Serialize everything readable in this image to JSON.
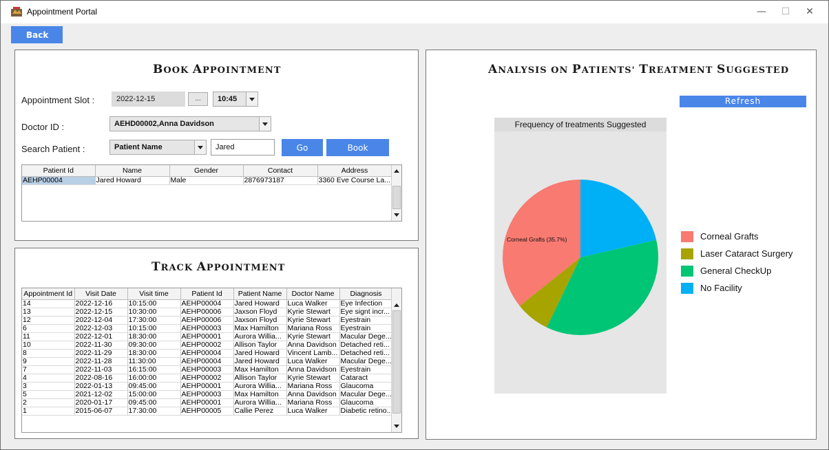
{
  "window": {
    "title": "Appointment Portal",
    "minimize": "—",
    "maximize": "☐",
    "close": "✕"
  },
  "back_label": "Back",
  "book": {
    "title_first": "B",
    "title_rest": "OOK ",
    "title_first2": "A",
    "title_rest2": "PPOINTMENT",
    "slot_label": "Appointment Slot :",
    "slot_date": "2022-12-15",
    "slot_picker": "...",
    "slot_time": "10:45",
    "doctor_label": "Doctor ID :",
    "doctor_value": "AEHD00002,Anna Davidson",
    "search_label": "Search Patient :",
    "search_by": "Patient Name",
    "search_text": "Jared",
    "go_label": "Go",
    "book_label": "Book",
    "table": {
      "headers": [
        "Patient Id",
        "Name",
        "Gender",
        "Contact",
        "Address"
      ],
      "rows": [
        [
          "AEHP00004",
          "Jared Howard",
          "Male",
          "2876973187",
          "3360 Eve Course La..."
        ]
      ]
    }
  },
  "track": {
    "title_first": "T",
    "title_rest": "RACK ",
    "title_first2": "A",
    "title_rest2": "PPOINTMENT",
    "table": {
      "headers": [
        "Appointment Id",
        "Visit Date",
        "Visit time",
        "Patient Id",
        "Patient Name",
        "Doctor Name",
        "Diagnosis"
      ],
      "rows": [
        [
          "14",
          "2022-12-16",
          "10:15:00",
          "AEHP00004",
          "Jared Howard",
          "Luca Walker",
          "Eye Infection"
        ],
        [
          "13",
          "2022-12-15",
          "10:30:00",
          "AEHP00006",
          "Jaxson Floyd",
          "Kyrie Stewart",
          "Eye signt incr..."
        ],
        [
          "12",
          "2022-12-04",
          "17:30:00",
          "AEHP00006",
          "Jaxson Floyd",
          "Kyrie Stewart",
          "Eyestrain"
        ],
        [
          "6",
          "2022-12-03",
          "10:15:00",
          "AEHP00003",
          "Max Hamilton",
          "Mariana Ross",
          "Eyestrain"
        ],
        [
          "11",
          "2022-12-01",
          "18:30:00",
          "AEHP00001",
          "Aurora Willia...",
          "Kyrie Stewart",
          "Macular Dege..."
        ],
        [
          "10",
          "2022-11-30",
          "09:30:00",
          "AEHP00002",
          "Allison Taylor",
          "Anna Davidson",
          "Detached reti..."
        ],
        [
          "8",
          "2022-11-29",
          "18:30:00",
          "AEHP00004",
          "Jared Howard",
          "Vincent Lamb...",
          "Detached reti..."
        ],
        [
          "9",
          "2022-11-28",
          "11:30:00",
          "AEHP00004",
          "Jared Howard",
          "Luca Walker",
          "Macular Dege..."
        ],
        [
          "7",
          "2022-11-03",
          "16:15:00",
          "AEHP00003",
          "Max Hamilton",
          "Anna Davidson",
          "Eyestrain"
        ],
        [
          "4",
          "2022-08-16",
          "16:00:00",
          "AEHP00002",
          "Allison Taylor",
          "Kyrie Stewart",
          "Cataract"
        ],
        [
          "3",
          "2022-01-13",
          "09:45:00",
          "AEHP00001",
          "Aurora Willia...",
          "Mariana Ross",
          "Glaucoma"
        ],
        [
          "5",
          "2021-12-02",
          "15:00:00",
          "AEHP00003",
          "Max Hamilton",
          "Anna Davidson",
          "Macular Dege..."
        ],
        [
          "2",
          "2020-01-17",
          "09:45:00",
          "AEHP00001",
          "Aurora Willia...",
          "Mariana Ross",
          "Glaucoma"
        ],
        [
          "1",
          "2015-06-07",
          "17:30:00",
          "AEHP00005",
          "Callie Perez",
          "Luca Walker",
          "Diabetic retino..."
        ]
      ]
    }
  },
  "analysis": {
    "title_parts": [
      "A",
      "NALYSIS ON ",
      "P",
      "ATIENTS' ",
      "T",
      "REATMENT ",
      "S",
      "UGGESTED"
    ],
    "refresh_label": "Refresh"
  },
  "chart_data": {
    "type": "pie",
    "title": "Frequency of treatments Suggested",
    "labels": [
      "Corneal Grafts",
      "Laser Cataract Surgery",
      "General CheckUp",
      "No Facility"
    ],
    "values": [
      35.7,
      7.1,
      35.7,
      21.4
    ],
    "colors": [
      "#f87a71",
      "#a7a400",
      "#00c575",
      "#00b0f6"
    ],
    "slice_label": "Corneal Grafts (35.7%)"
  }
}
